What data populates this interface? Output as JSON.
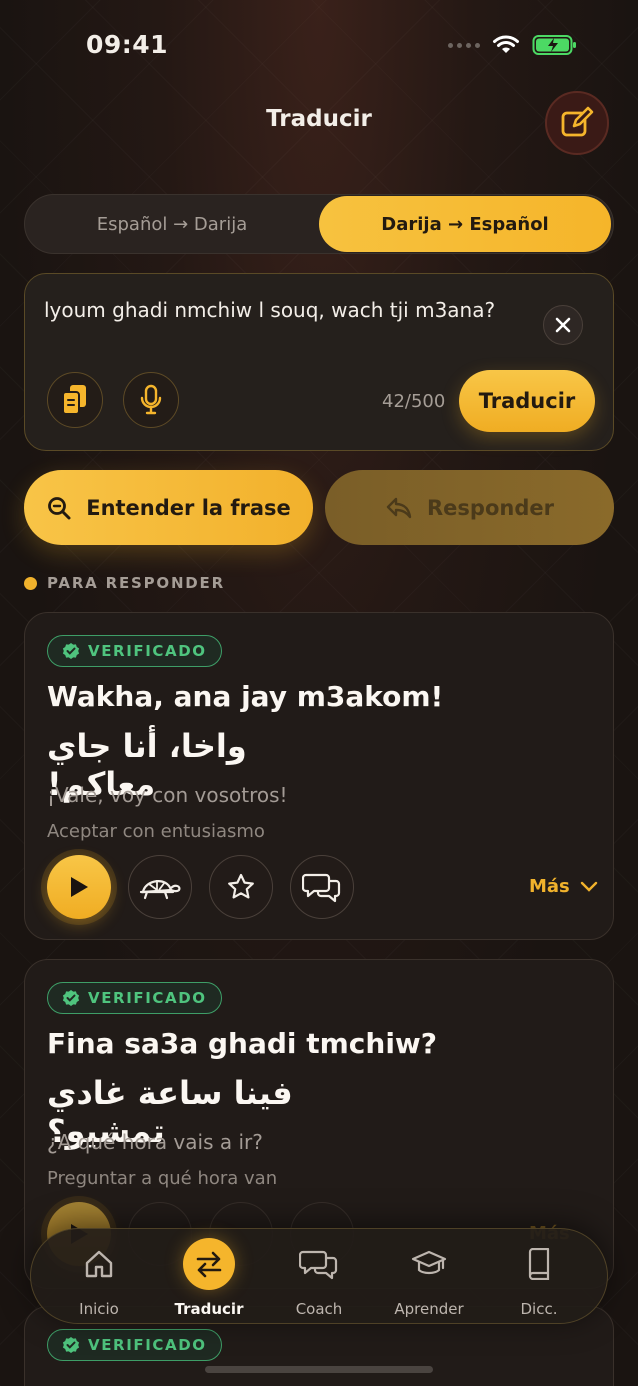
{
  "status": {
    "time": "09:41"
  },
  "header": {
    "title": "Traducir"
  },
  "direction": {
    "left": "Español → Darija",
    "right": "Darija → Español"
  },
  "input": {
    "value": "lyoum ghadi nmchiw l souq, wach tji m3ana?",
    "counter": "42/500",
    "translate_label": "Traducir"
  },
  "actions": {
    "entender": "Entender la frase",
    "responder": "Responder"
  },
  "section": {
    "label": "PARA RESPONDER"
  },
  "cards": [
    {
      "badge": "VERIFICADO",
      "phrase": "Wakha, ana jay m3akom!",
      "arabic": "واخا، أنا جاي معاكم!",
      "spanish": "¡Vale, voy con vosotros!",
      "context": "Aceptar con entusiasmo",
      "more": "Más"
    },
    {
      "badge": "VERIFICADO",
      "phrase": "Fina sa3a ghadi tmchiw?",
      "arabic": "فينا ساعة غادي تمشيو؟",
      "spanish": "¿A qué hora vais a ir?",
      "context": "Preguntar a qué hora van",
      "more": "Más"
    },
    {
      "badge": "VERIFICADO"
    }
  ],
  "tabs": [
    {
      "label": "Inicio",
      "icon": "home-icon"
    },
    {
      "label": "Traducir",
      "icon": "swap-icon",
      "active": true
    },
    {
      "label": "Coach",
      "icon": "chat-icon"
    },
    {
      "label": "Aprender",
      "icon": "graduation-cap-icon"
    },
    {
      "label": "Dicc.",
      "icon": "book-icon"
    }
  ],
  "colors": {
    "accent": "#f5b52c",
    "verified": "#4fc47e",
    "background": "#1b1512"
  }
}
